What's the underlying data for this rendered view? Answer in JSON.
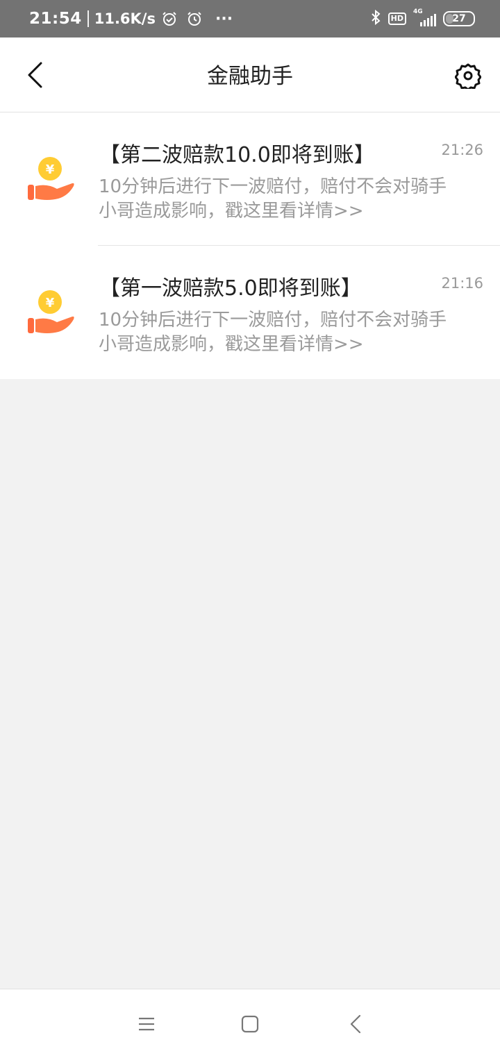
{
  "status_bar": {
    "time": "21:54",
    "net_speed": "11.6K/s",
    "more": "···",
    "hd": "HD",
    "network": "4G",
    "battery": "27"
  },
  "header": {
    "title": "金融助手"
  },
  "messages": [
    {
      "title": "【第二波赔款10.0即将到账】",
      "time": "21:26",
      "body": "10分钟后进行下一波赔付，赔付不会对骑手小哥造成影响，戳这里看详情>>",
      "icon": "coin-hand-icon"
    },
    {
      "title": "【第一波赔款5.0即将到账】",
      "time": "21:16",
      "body": "10分钟后进行下一波赔付，赔付不会对骑手小哥造成影响，戳这里看详情>>",
      "icon": "coin-hand-icon"
    }
  ],
  "colors": {
    "coin": "#ffcc33",
    "hand": "#ff6a3d",
    "page_bg": "#f2f2f2"
  }
}
